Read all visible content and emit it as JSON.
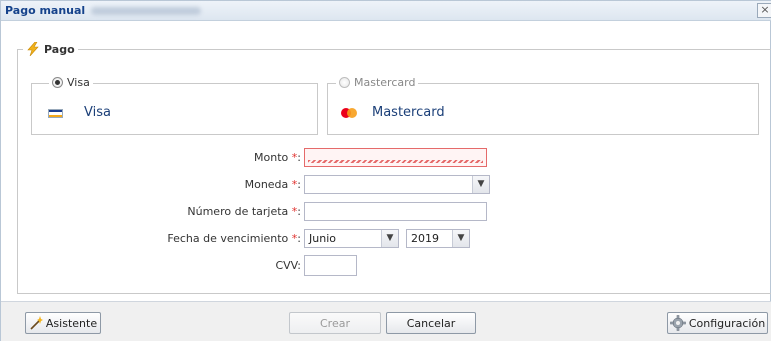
{
  "window": {
    "title": "Pago manual",
    "close_label": "×"
  },
  "payment": {
    "legend": "Pago",
    "icon": "lightning-bolt-icon",
    "cards": [
      {
        "legend": "Visa",
        "name": "Visa",
        "selected": true,
        "icon": "visa-logo-icon"
      },
      {
        "legend": "Mastercard",
        "name": "Mastercard",
        "selected": false,
        "icon": "mastercard-logo-icon"
      }
    ]
  },
  "form": {
    "amount": {
      "label": "Monto",
      "required_mark": "*",
      "colon": ":",
      "value": ""
    },
    "currency": {
      "label": "Moneda",
      "required_mark": "*",
      "colon": ":",
      "value": ""
    },
    "card_number": {
      "label": "Número de tarjeta",
      "required_mark": "*",
      "colon": ":",
      "value": ""
    },
    "expiry": {
      "label": "Fecha de vencimiento",
      "required_mark": "*",
      "colon": ":",
      "month": "Junio",
      "year": "2019"
    },
    "cvv": {
      "label": "CVV",
      "colon": ":",
      "value": ""
    }
  },
  "footer": {
    "wizard_label": "Asistente",
    "create_label": "Crear",
    "cancel_label": "Cancelar",
    "settings_label": "Configuración"
  },
  "colors": {
    "title": "#15428b",
    "required": "#e0302d",
    "card_name": "#1b3f78"
  }
}
